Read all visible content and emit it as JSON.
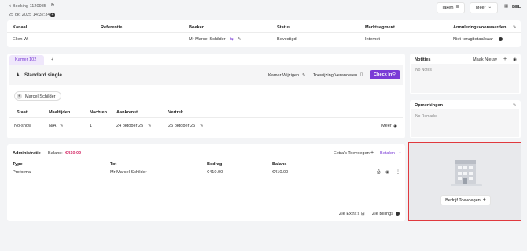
{
  "header": {
    "breadcrumb": "< Boeking 1120985",
    "datetime": "25 okt 2025 14:32:34",
    "taken_label": "Taken",
    "meer_label": "Meer",
    "country": "BEL"
  },
  "booking_table": {
    "columns": [
      "Kanaal",
      "Referentie",
      "Boeker",
      "Status",
      "Marktsegment",
      "Annuleringsvoorwaarden"
    ],
    "row": {
      "kanaal": "Ellen W.",
      "referentie": "-",
      "boeker": "Mr Marcel Schilder",
      "status": "Bevestigd",
      "marktsegment": "Internet",
      "annulering": "Niet-terugbetaalbaar"
    }
  },
  "room": {
    "tab_label": "Kamer 102",
    "add_tab": "+",
    "room_type": "Standard single",
    "kamer_wijzigen": "Kamer Wijzigen",
    "toewijzing_veranderen": "Toewijzing Veranderen",
    "check_in": "Check In",
    "guest_name": "Marcel Schilder",
    "stay_columns": [
      "Staat",
      "Maaltijden",
      "Nachten",
      "Aankomst",
      "Vertrek"
    ],
    "stay_row": {
      "staat": "No-show",
      "maaltijden": "N/A",
      "nachten": "1",
      "aankomst": "24 oktober 25",
      "vertrek": "25 oktober 25",
      "meer": "Meer"
    }
  },
  "notities": {
    "title": "Notities",
    "maak_nieuw": "Maak Nieuw",
    "empty": "No Notes"
  },
  "opmerkingen": {
    "title": "Opmerkingen",
    "empty": "No Remarks"
  },
  "bedrijf": {
    "button_label": "Bedrijf Toevoegen",
    "highlight_color": "#e0393e"
  },
  "administratie": {
    "title": "Administratie",
    "balans_label": "Balans:",
    "balans_value": "€410.00",
    "extras_label": "Extra's Toevoegen",
    "betalen_label": "Betalen",
    "columns": [
      "Type",
      "Tot",
      "Bedrag",
      "Balans"
    ],
    "row": {
      "type": "Proforma",
      "tot": "Mr Marcel Schilder",
      "bedrag": "€410.00",
      "balans": "€410.00"
    },
    "zie_extras": "Zie Extra's",
    "zie_billings": "Zie Billings"
  },
  "colors": {
    "accent": "#7a3bd6",
    "balance": "#d6336c",
    "page_bg": "#f3f4f6"
  }
}
